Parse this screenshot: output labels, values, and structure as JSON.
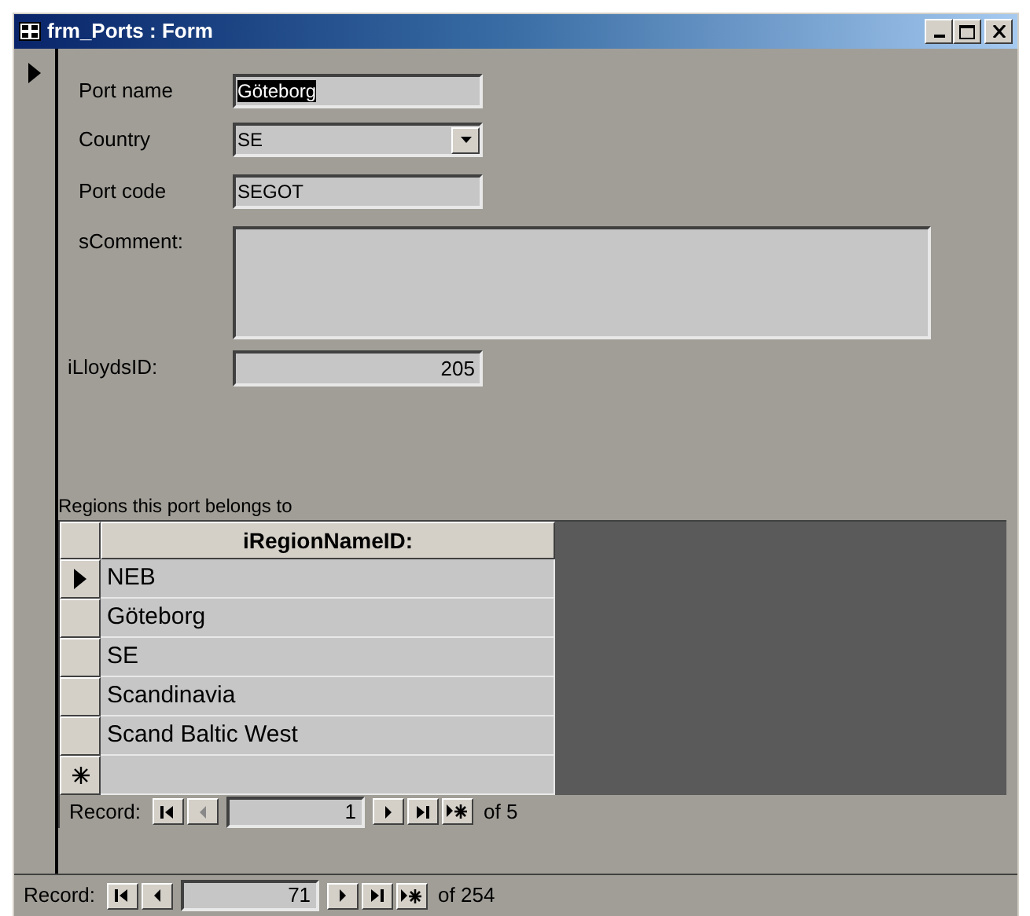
{
  "window": {
    "title": "frm_Ports : Form"
  },
  "record_selector": {
    "current": true
  },
  "fields": [
    {
      "label": "Port name",
      "value": "Göteborg",
      "kind": "text",
      "highlighted": true
    },
    {
      "label": "Country",
      "value": "SE",
      "kind": "combo"
    },
    {
      "label": "Port code",
      "value": "SEGOT",
      "kind": "text",
      "highlighted": false
    },
    {
      "label": "sComment:",
      "kind": "memo"
    },
    {
      "label": "iLloydsID:",
      "value": "205",
      "kind": "number"
    }
  ],
  "subform": {
    "label": "Regions this port belongs to",
    "column": "iRegionNameID:",
    "rows": [
      {
        "value": "NEB",
        "current": true
      },
      {
        "value": "Göteborg",
        "current": false
      },
      {
        "value": "SE",
        "current": false
      },
      {
        "value": "Scandinavia",
        "current": false
      },
      {
        "value": "Scand Baltic West",
        "current": false
      }
    ],
    "navigation": {
      "label": "Record:",
      "number": "1",
      "total": "of 5",
      "first_disabled": false,
      "prev_disabled": true
    }
  },
  "navigation": {
    "label": "Record:",
    "number": "71",
    "total": "of 254",
    "first_disabled": false,
    "prev_disabled": false
  }
}
